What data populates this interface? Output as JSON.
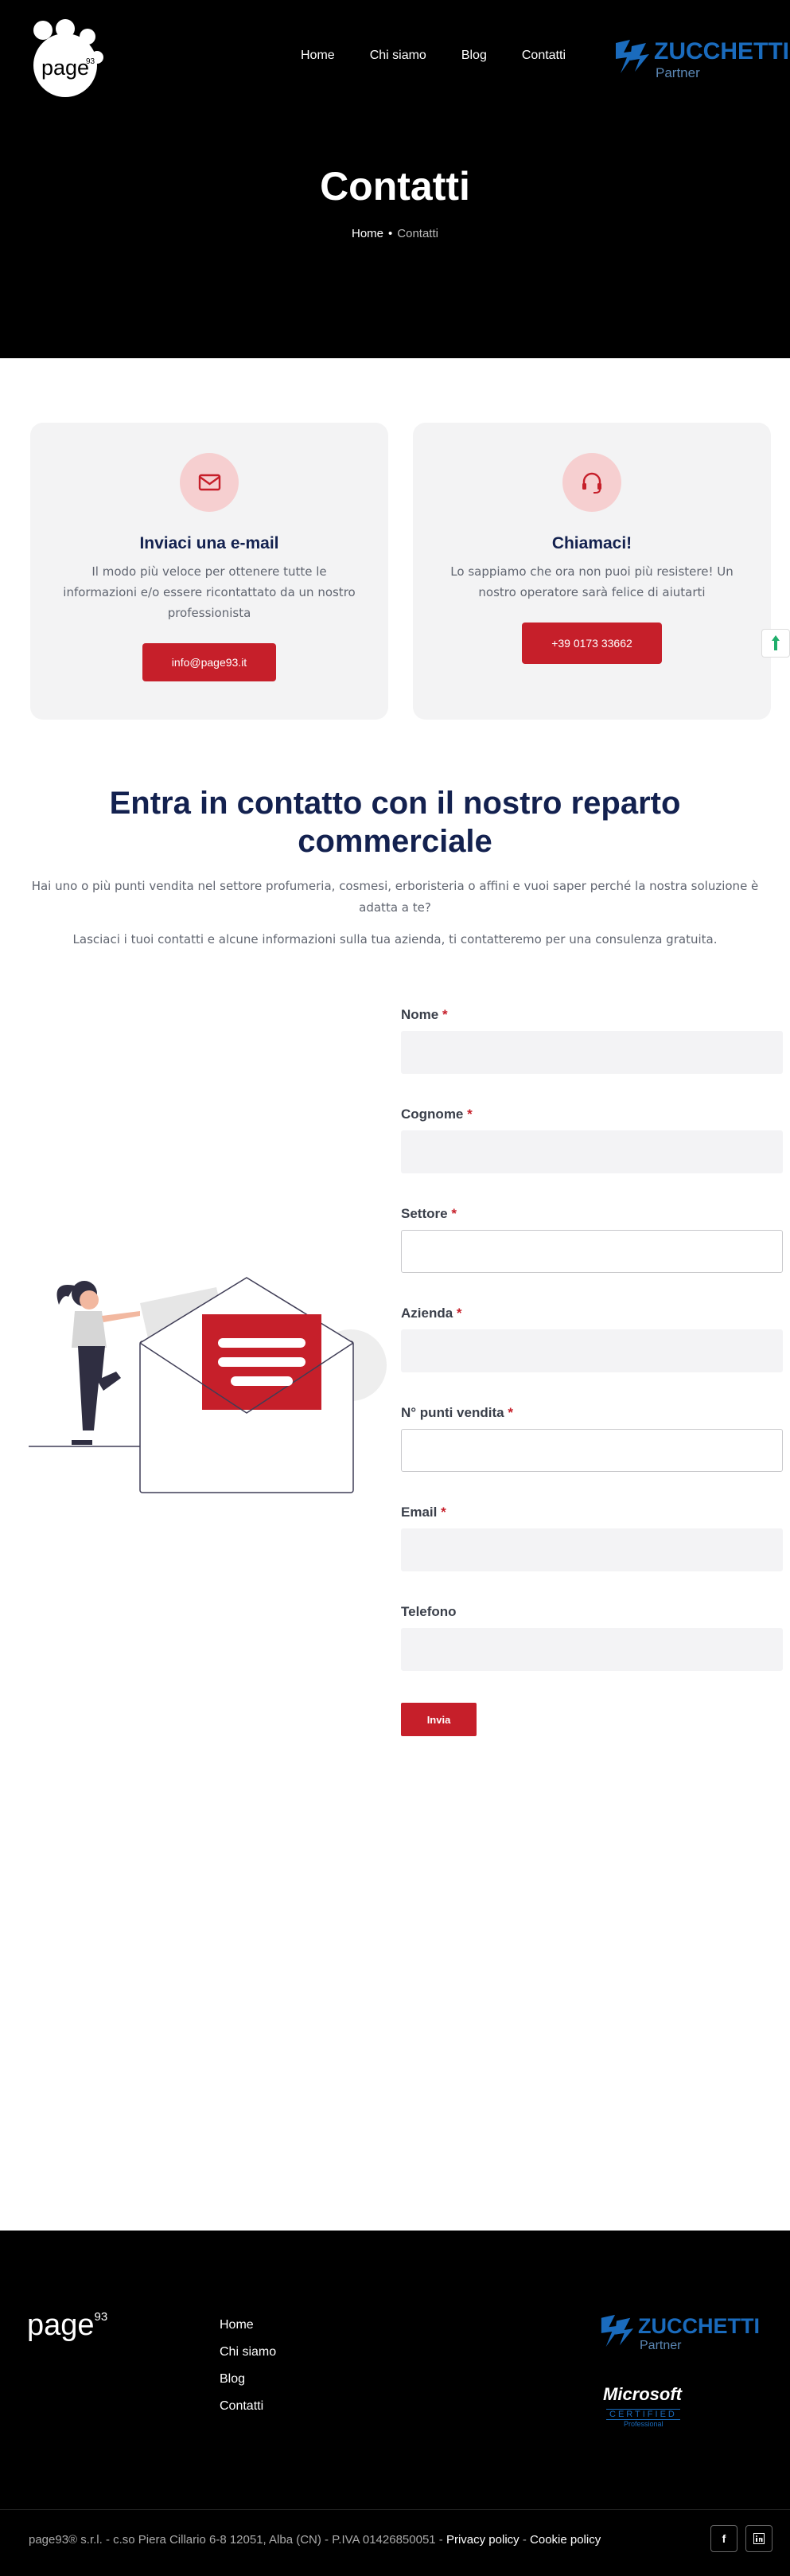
{
  "header": {
    "logo_text": "page",
    "logo_sup": "93",
    "nav": [
      "Home",
      "Chi siamo",
      "Blog",
      "Contatti"
    ],
    "partner": {
      "brand": "ZUCCHETTI",
      "sub": "Partner"
    }
  },
  "hero": {
    "title": "Contatti",
    "breadcrumb_home": "Home",
    "breadcrumb_current": "Contatti"
  },
  "cards": [
    {
      "icon": "envelope-icon",
      "title": "Inviaci una e-mail",
      "text": "Il modo più veloce per ottenere tutte le informazioni e/o essere ricontattato da un nostro professionista",
      "button": "info@page93.it"
    },
    {
      "icon": "headset-icon",
      "title": "Chiamaci!",
      "text": "Lo sappiamo che ora non puoi più resistere! Un nostro operatore sarà felice di aiutarti",
      "button": "+39 0173 33662"
    }
  ],
  "section": {
    "title": "Entra in contatto con il nostro reparto commerciale",
    "subtitle_1": "Hai uno o più punti vendita nel settore profumeria, cosmesi, erboristeria o affini e vuoi saper perché la nostra soluzione è adatta a te?",
    "subtitle_2": "Lasciaci i tuoi contatti e alcune informazioni sulla tua azienda, ti contatteremo per una consulenza gratuita."
  },
  "form": {
    "required_mark": "*",
    "fields": [
      {
        "label": "Nome",
        "required": true,
        "value": ""
      },
      {
        "label": "Cognome",
        "required": true,
        "value": ""
      },
      {
        "label": "Settore",
        "required": true,
        "value": ""
      },
      {
        "label": "Azienda",
        "required": true,
        "value": ""
      },
      {
        "label": "N° punti vendita",
        "required": true,
        "value": ""
      },
      {
        "label": "Email",
        "required": true,
        "value": ""
      },
      {
        "label": "Telefono",
        "required": false,
        "value": ""
      }
    ],
    "submit": "Invia"
  },
  "footer": {
    "logo_text": "page",
    "logo_sup": "93",
    "links": [
      "Home",
      "Chi siamo",
      "Blog",
      "Contatti"
    ],
    "partner": {
      "brand": "ZUCCHETTI",
      "sub": "Partner"
    },
    "microsoft": {
      "name": "Microsoft",
      "certified": "CERTIFIED",
      "level": "Professional"
    },
    "copyright": "page93® s.r.l. - c.so Piera Cillario 6-8 12051, Alba (CN) - P.IVA 01426850051 -",
    "privacy": "Privacy policy",
    "separator": "-",
    "cookie": "Cookie policy",
    "social": [
      "facebook-icon",
      "linkedin-icon"
    ]
  },
  "colors": {
    "accent": "#c61f2a",
    "navy": "#13214f",
    "zucchetti_blue": "#1a6bbd"
  }
}
